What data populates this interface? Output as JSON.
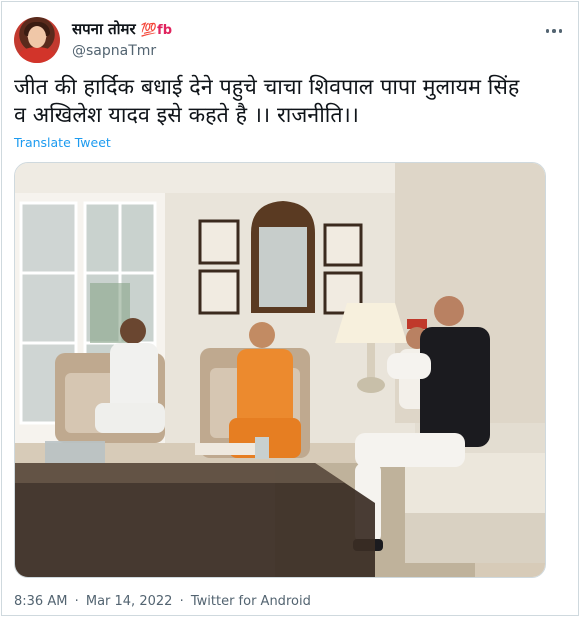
{
  "tweet": {
    "display_name": "सपना तोमर",
    "name_emoji": "💯fb",
    "handle": "@sapnaTmr",
    "text_line1": "जीत की हार्दिक बधाई देने पहुचे चाचा शिवपाल पापा मुलायम सिंह",
    "text_line2": "व अखिलेश यादव इसे कहते है ।। राजनीति।।",
    "translate_label": "Translate Tweet",
    "time": "8:36 AM",
    "date": "Mar 14, 2022",
    "source": "Twitter for Android",
    "separator": "·"
  },
  "icons": {
    "more": "more-options-icon"
  }
}
